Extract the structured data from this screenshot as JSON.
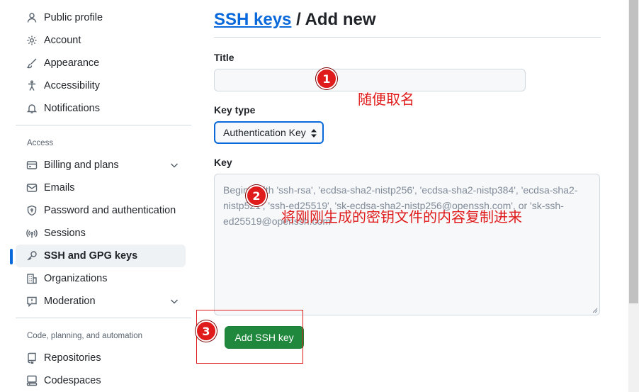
{
  "sidebar": {
    "top_items": [
      {
        "label": "Public profile",
        "icon": "person-icon"
      },
      {
        "label": "Account",
        "icon": "gear-icon"
      },
      {
        "label": "Appearance",
        "icon": "paintbrush-icon"
      },
      {
        "label": "Accessibility",
        "icon": "accessibility-icon"
      },
      {
        "label": "Notifications",
        "icon": "bell-icon"
      }
    ],
    "access_title": "Access",
    "access_items": [
      {
        "label": "Billing and plans",
        "icon": "credit-card-icon",
        "expandable": true
      },
      {
        "label": "Emails",
        "icon": "mail-icon"
      },
      {
        "label": "Password and authentication",
        "icon": "shield-lock-icon"
      },
      {
        "label": "Sessions",
        "icon": "broadcast-icon"
      },
      {
        "label": "SSH and GPG keys",
        "icon": "key-icon",
        "active": true
      },
      {
        "label": "Organizations",
        "icon": "organization-icon"
      },
      {
        "label": "Moderation",
        "icon": "report-icon",
        "expandable": true
      }
    ],
    "code_title": "Code, planning, and automation",
    "code_items": [
      {
        "label": "Repositories",
        "icon": "repo-icon"
      },
      {
        "label": "Codespaces",
        "icon": "codespaces-icon"
      }
    ]
  },
  "main": {
    "breadcrumb_link": "SSH keys",
    "heading_rest": " / Add new",
    "title_label": "Title",
    "title_value": "",
    "key_type_label": "Key type",
    "key_type_value": "Authentication Key",
    "key_label": "Key",
    "key_placeholder": "Begins with 'ssh-rsa', 'ecdsa-sha2-nistp256', 'ecdsa-sha2-nistp384', 'ecdsa-sha2-nistp521', 'ssh-ed25519', 'sk-ecdsa-sha2-nistp256@openssh.com', or 'sk-ssh-ed25519@openssh.com'",
    "add_button": "Add SSH key"
  },
  "annotations": {
    "badge1": "1",
    "note1": "随便取名",
    "badge2": "2",
    "note2": "将刚刚生成的密钥文件的内容复制进来",
    "badge3": "3",
    "color": "#e01b1b"
  }
}
